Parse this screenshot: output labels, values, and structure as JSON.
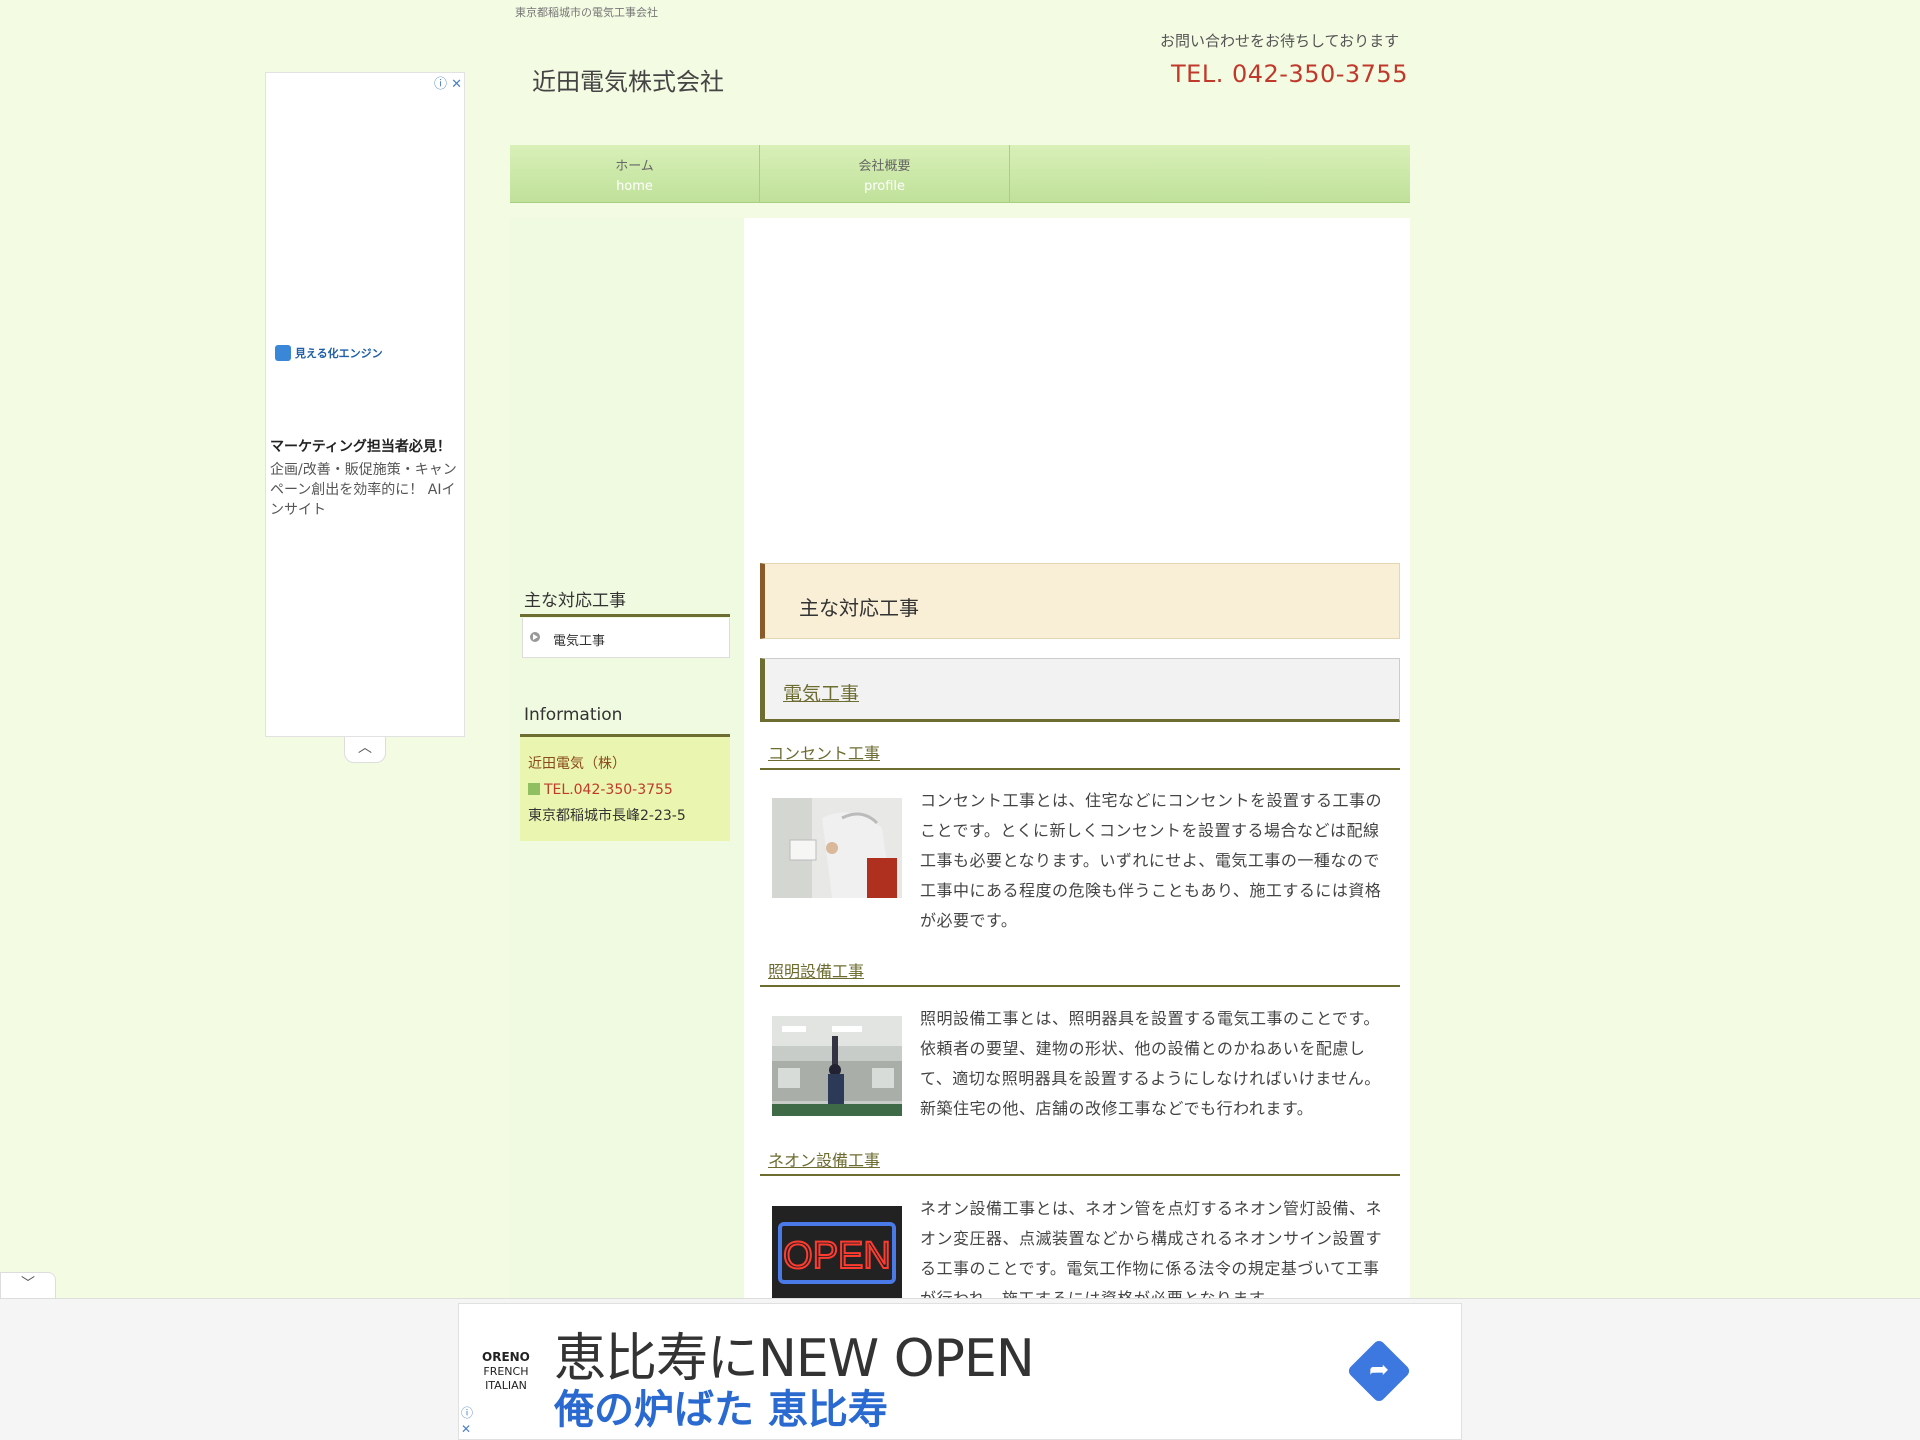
{
  "header": {
    "tagline": "東京都稲城市の電気工事会社",
    "site_title": "近田電気株式会社",
    "contact_msg": "お問い合わせをお待ちしております",
    "tel": "TEL. 042-350-3755"
  },
  "nav": {
    "items": [
      {
        "jp": "ホーム",
        "en": "home"
      },
      {
        "jp": "会社概要",
        "en": "profile"
      }
    ]
  },
  "sidebar": {
    "categories_heading": "主な対応工事",
    "categories": [
      "電気工事"
    ],
    "info_heading": "Information",
    "info_name": "近田電気（株）",
    "info_tel": "TEL.042-350-3755",
    "info_addr": "東京都稲城市長峰2-23-5"
  },
  "main": {
    "page_heading": "主な対応工事",
    "category_heading": "電気工事",
    "items": [
      {
        "title": "コンセント工事",
        "text": "コンセント工事とは、住宅などにコンセントを設置する工事のことです。とくに新しくコンセントを設置する場合などは配線工事も必要となります。いずれにせよ、電気工事の一種なので工事中にある程度の危険も伴うこともあり、施工するには資格が必要です。"
      },
      {
        "title": "照明設備工事",
        "text": "照明設備工事とは、照明器具を設置する電気工事のことです。依頼者の要望、建物の形状、他の設備とのかねあいを配慮して、適切な照明器具を設置するようにしなければいけません。新築住宅の他、店舗の改修工事などでも行われます。"
      },
      {
        "title": "ネオン設備工事",
        "text": "ネオン設備工事とは、ネオン管を点灯するネオン管灯設備、ネオン変圧器、点滅装置などから構成されるネオンサイン設置する工事のことです。電気工作物に係る法令の規定基づいて工事が行われ、施工するには資格が必要となります。",
        "sign_text": "OPEN"
      }
    ]
  },
  "ad_left": {
    "logo_text": "見える化エンジン",
    "heading": "マーケティング担当者必見！",
    "body": "企画/改善・販促施策・キャンペーン創出を効率的に！ AIインサイト"
  },
  "ad_bottom": {
    "brand_line1": "ORENO",
    "brand_line2": "FRENCH",
    "brand_line3": "ITALIAN",
    "title": "恵比寿にNEW OPEN",
    "subtitle": "俺の炉ばた 恵比寿"
  },
  "colors": {
    "background": "#f3fbe3",
    "nav": "#c8e6a3",
    "accent_olive": "#6d6d32",
    "tel_red": "#c0392b",
    "ad_blue": "#2a6ad0"
  }
}
